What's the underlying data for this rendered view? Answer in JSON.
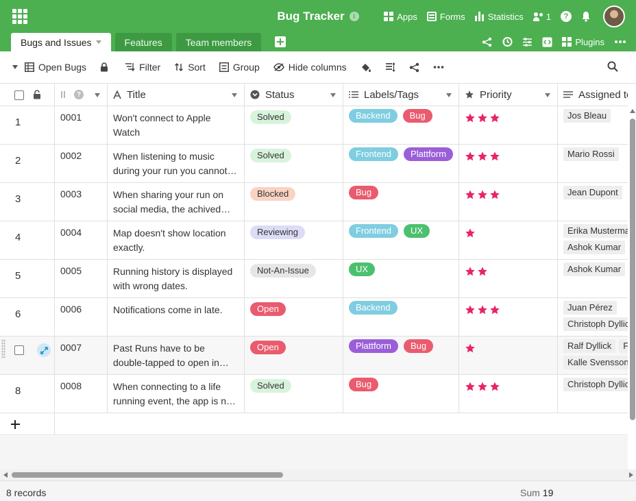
{
  "app": {
    "title": "Bug Tracker"
  },
  "topbar": {
    "apps": "Apps",
    "forms": "Forms",
    "statistics": "Statistics",
    "collaborators_count": "1"
  },
  "tabs": [
    {
      "label": "Bugs and Issues",
      "active": true
    },
    {
      "label": "Features",
      "active": false
    },
    {
      "label": "Team members",
      "active": false
    }
  ],
  "tab_tools": {
    "plugins": "Plugins"
  },
  "toolbar": {
    "view": "Open Bugs",
    "filter": "Filter",
    "sort": "Sort",
    "group": "Group",
    "hide_columns": "Hide columns"
  },
  "columns": {
    "title": "Title",
    "status": "Status",
    "labels": "Labels/Tags",
    "priority": "Priority",
    "assigned": "Assigned to"
  },
  "status_colors": {
    "Solved": "#d8f3dc",
    "Blocked": "#fbd3c3",
    "Reviewing": "#dcdcf8",
    "Not-An-Issue": "#e6e6e6",
    "Open": "#ea5b6e"
  },
  "label_colors": {
    "Backend": "#7fcde0",
    "Bug": "#ea5b6e",
    "Frontend": "#7fcde0",
    "Plattform": "#9a5fd8",
    "UX": "#4cc06e"
  },
  "priority_color": "#e9236a",
  "rows": [
    {
      "num": "1",
      "id": "0001",
      "title": "Won't connect to Apple Watch",
      "status": "Solved",
      "labels": [
        "Backend",
        "Bug"
      ],
      "priority": 3,
      "assigned": [
        [
          "Jos Bleau"
        ]
      ]
    },
    {
      "num": "2",
      "id": "0002",
      "title": "When listening to music during your run you cannot change the song",
      "status": "Solved",
      "labels": [
        "Frontend",
        "Plattform"
      ],
      "priority": 3,
      "assigned": [
        [
          "Mario Rossi"
        ]
      ]
    },
    {
      "num": "3",
      "id": "0003",
      "title": "When sharing your run on social media, the achived time is not shown",
      "status": "Blocked",
      "labels": [
        "Bug"
      ],
      "priority": 3,
      "assigned": [
        [
          "Jean Dupont"
        ]
      ]
    },
    {
      "num": "4",
      "id": "0004",
      "title": "Map doesn't show location exactly.",
      "status": "Reviewing",
      "labels": [
        "Frontend",
        "UX"
      ],
      "priority": 1,
      "assigned": [
        [
          "Erika Mustermann"
        ],
        [
          "Ashok Kumar"
        ]
      ]
    },
    {
      "num": "5",
      "id": "0005",
      "title": "Running history is displayed with wrong dates.",
      "status": "Not-An-Issue",
      "labels": [
        "UX"
      ],
      "priority": 2,
      "assigned": [
        [
          "Ashok Kumar"
        ]
      ]
    },
    {
      "num": "6",
      "id": "0006",
      "title": "Notifications come in late.",
      "status": "Open",
      "labels": [
        "Backend"
      ],
      "priority": 3,
      "assigned": [
        [
          "Juan Pérez"
        ],
        [
          "Christoph Dyllick"
        ]
      ]
    },
    {
      "num": "7",
      "id": "0007",
      "title": "Past Runs have to be double-tapped to open in Android.",
      "status": "Open",
      "labels": [
        "Plattform",
        "Bug"
      ],
      "priority": 1,
      "assigned": [
        [
          "Ralf Dyllick",
          "F"
        ],
        [
          "Kalle Svensson"
        ]
      ],
      "hovered": true
    },
    {
      "num": "8",
      "id": "0008",
      "title": "When connecting to a life running event, the app is not responding",
      "status": "Solved",
      "labels": [
        "Bug"
      ],
      "priority": 3,
      "assigned": [
        [
          "Christoph Dyllick"
        ]
      ]
    }
  ],
  "footer": {
    "records": "8 records",
    "sum_label": "Sum",
    "sum_value": "19"
  }
}
